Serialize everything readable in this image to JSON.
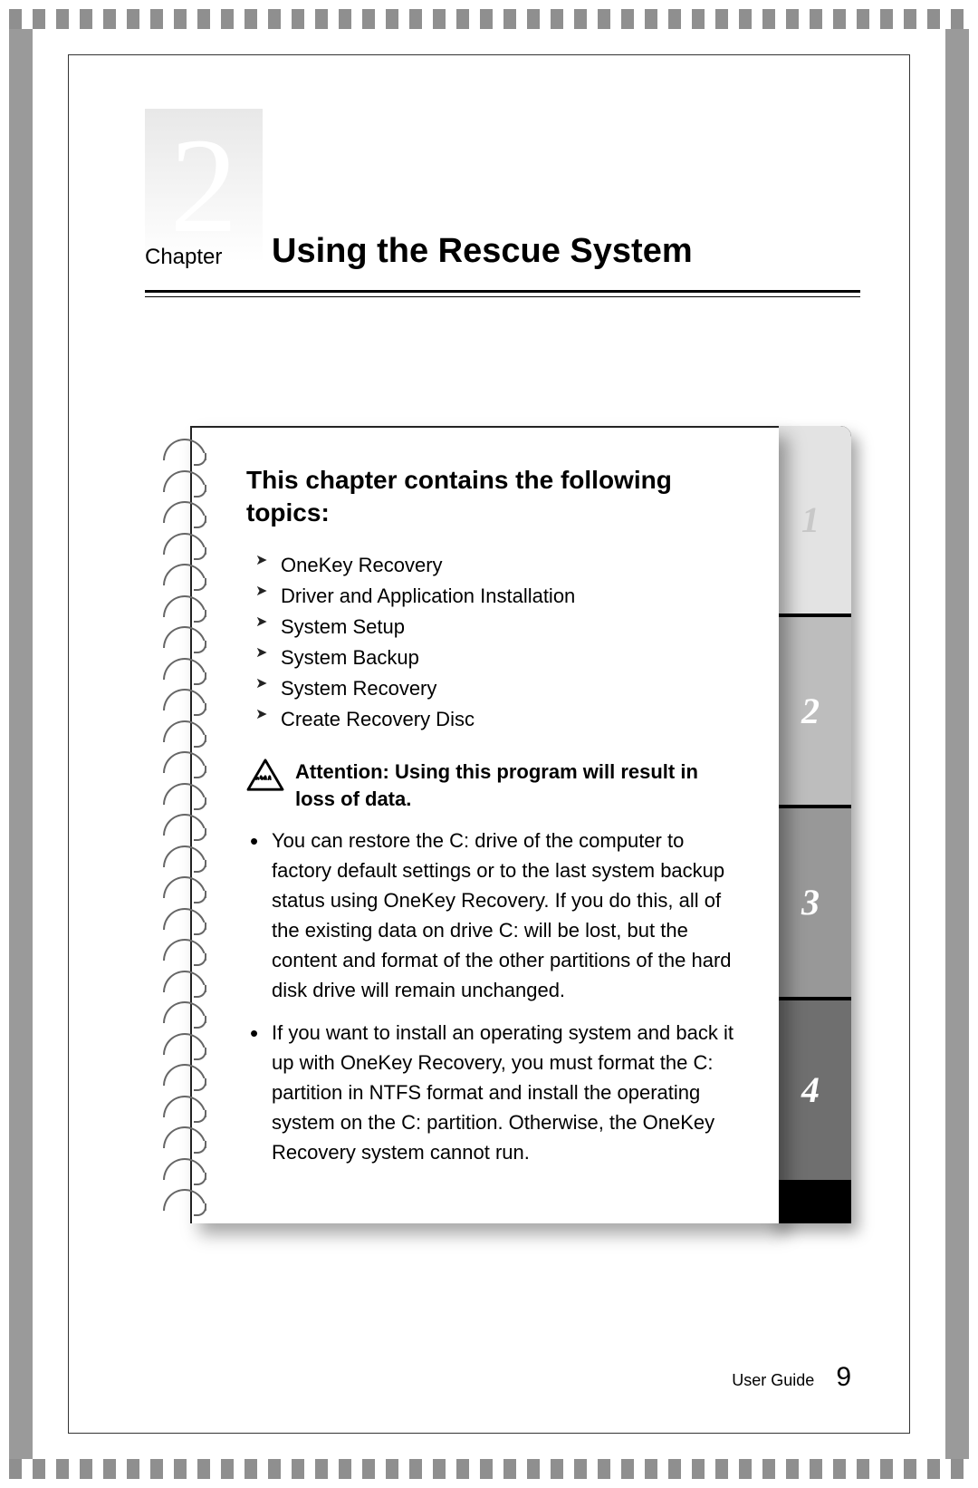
{
  "chapter": {
    "number": "2",
    "label": "Chapter",
    "title": "Using the Rescue System"
  },
  "topics": {
    "heading": "This chapter contains the following topics:",
    "items": [
      "OneKey Recovery",
      "Driver and Application Installation",
      "System Setup",
      "System Backup",
      "System Recovery",
      "Create Recovery Disc"
    ]
  },
  "attention": {
    "text": "Attention: Using this program will result in loss of data."
  },
  "bullets": [
    "You can restore the C: drive of the computer to factory default settings or to the last system backup status using OneKey Recovery. If you do this, all of the existing data on drive C: will be lost, but the content and format of the other partitions of the hard disk drive will remain unchanged.",
    "If you want to install an operating system and back it up with OneKey Recovery, you must format the C: partition in NTFS format and install the operating system on the C: partition. Otherwise, the OneKey Recovery system cannot run."
  ],
  "tabs": [
    "1",
    "2",
    "3",
    "4"
  ],
  "footer": {
    "label": "User Guide",
    "page": "9"
  }
}
